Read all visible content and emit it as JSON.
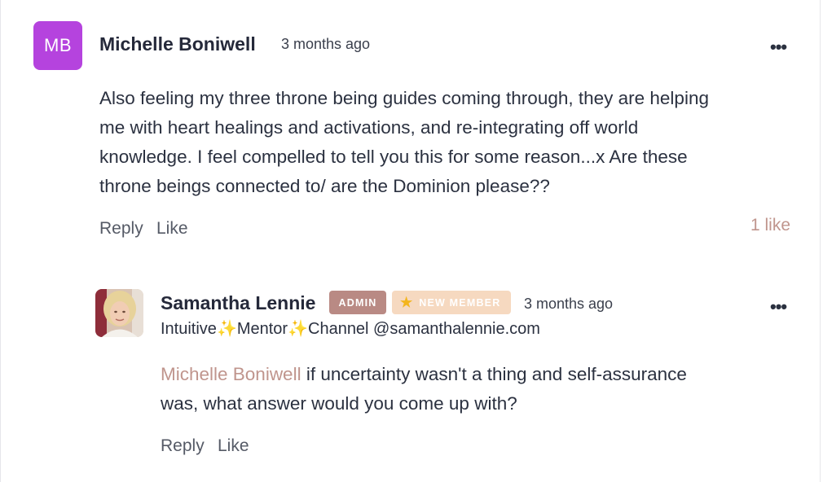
{
  "comment": {
    "avatar_initials": "MB",
    "author": "Michelle Boniwell",
    "time": "3 months ago",
    "menu": "•••",
    "lines": [
      "Also feeling my three throne being guides coming through, they are helping",
      "me with heart healings and activations, and re-integrating off world",
      "knowledge. I feel compelled to tell you this for some reason...x Are these",
      "throne beings connected to/ are the Dominion please??"
    ],
    "reply_label": "Reply",
    "like_label": "Like",
    "like_count": "1 like",
    "avatar_color": "#b543de"
  },
  "reply": {
    "author": "Samantha Lennie",
    "badge_admin": "ADMIN",
    "badge_new": "NEW MEMBER",
    "badge_new_icon": "star-icon",
    "time": "3 months ago",
    "menu": "•••",
    "bio_parts": [
      "Intuitive",
      "Mentor",
      "Channel @samanthalennie.com"
    ],
    "sparkle": "✨",
    "mention": "Michelle Boniwell",
    "line1_rest": " if uncertainty wasn't a thing and self-assurance",
    "line2": "was, what answer would you come up with?",
    "reply_label": "Reply",
    "like_label": "Like",
    "mention_color": "#c0958d"
  }
}
